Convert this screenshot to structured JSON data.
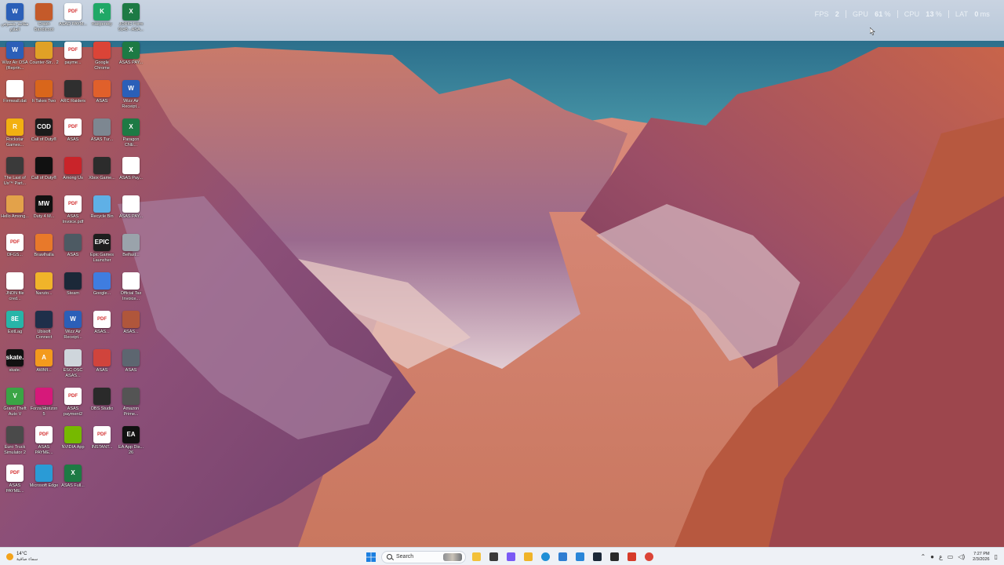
{
  "performance_overlay": {
    "fps": {
      "label": "FPS",
      "value": "2",
      "unit": ""
    },
    "gpu": {
      "label": "GPU",
      "value": "61",
      "unit": "%"
    },
    "cpu": {
      "label": "CPU",
      "value": "13",
      "unit": "%"
    },
    "latency": {
      "label": "LAT",
      "value": "0",
      "unit": "ms"
    }
  },
  "desktop_icons": [
    {
      "label": "مكاتبة بخصوص العلاج",
      "icon": "word-doc-icon",
      "badge": "W",
      "color": "#2b5fb8"
    },
    {
      "label": "Crash Bandicoot",
      "icon": "game-icon",
      "badge": "",
      "color": "#c45a2a"
    },
    {
      "label": "ASAD PAYM...",
      "icon": "pdf-icon",
      "badge": "PDF",
      "color": "#ffffff"
    },
    {
      "label": "Kaspersky",
      "icon": "kaspersky-icon",
      "badge": "K",
      "color": "#1fa866"
    },
    {
      "label": "JORIC Form 9145 - ASA...",
      "icon": "excel-icon",
      "badge": "X",
      "color": "#1d7a44"
    },
    {
      "label": "Wizz Air OSA (Reprin...",
      "icon": "word-doc-icon",
      "badge": "W",
      "color": "#2b5fb8"
    },
    {
      "label": "Counter-Str... 2",
      "icon": "game-icon",
      "badge": "",
      "color": "#e0a126"
    },
    {
      "label": "payme...",
      "icon": "pdf-icon",
      "badge": "PDF",
      "color": "#ffffff"
    },
    {
      "label": "Google Chrome",
      "icon": "chrome-icon",
      "badge": "",
      "color": "#db4437"
    },
    {
      "label": "ASAS PAY...",
      "icon": "excel-icon",
      "badge": "X",
      "color": "#1d7a44"
    },
    {
      "label": "Firmwall.dat",
      "icon": "file-icon",
      "badge": "",
      "color": "#ffffff"
    },
    {
      "label": "It Takes Two",
      "icon": "game-icon",
      "badge": "",
      "color": "#d9661b"
    },
    {
      "label": "ARC Raiders",
      "icon": "game-icon",
      "badge": "",
      "color": "#2f2f2f"
    },
    {
      "label": "ASAS",
      "icon": "game-icon",
      "badge": "",
      "color": "#e0602b"
    },
    {
      "label": "Wizz Air Receipt...",
      "icon": "word-doc-icon",
      "badge": "W",
      "color": "#2b5fb8"
    },
    {
      "label": "Rockstar Games...",
      "icon": "rockstar-icon",
      "badge": "R",
      "color": "#f2b011"
    },
    {
      "label": "Call of Duty®",
      "icon": "game-icon",
      "badge": "COD",
      "color": "#1b1b1b"
    },
    {
      "label": "ASAS",
      "icon": "pdf-icon",
      "badge": "PDF",
      "color": "#ffffff"
    },
    {
      "label": "ASAS Tur...",
      "icon": "app-icon",
      "badge": "",
      "color": "#7d8791"
    },
    {
      "label": "Paragon CNE...",
      "icon": "excel-icon",
      "badge": "X",
      "color": "#1d7a44"
    },
    {
      "label": "The Last of Us™ Part...",
      "icon": "game-icon",
      "badge": "",
      "color": "#3a3a3a"
    },
    {
      "label": "Call of Duty®",
      "icon": "game-icon",
      "badge": "",
      "color": "#111111"
    },
    {
      "label": "Among Us",
      "icon": "game-icon",
      "badge": "",
      "color": "#c9242a"
    },
    {
      "label": "Xbox Game...",
      "icon": "xbox-icon",
      "badge": "",
      "color": "#2c2c2c"
    },
    {
      "label": "ASAS Pay...",
      "icon": "file-icon",
      "badge": "",
      "color": "#ffffff"
    },
    {
      "label": "Hello Among...",
      "icon": "game-icon",
      "badge": "",
      "color": "#e3a24a"
    },
    {
      "label": "Duty 4 M...",
      "icon": "game-icon",
      "badge": "MW",
      "color": "#111111"
    },
    {
      "label": "ASAS Invoice.pdf",
      "icon": "pdf-icon",
      "badge": "PDF",
      "color": "#ffffff"
    },
    {
      "label": "Recycle Bin",
      "icon": "recycle-bin-icon",
      "badge": "",
      "color": "#5fb0e6"
    },
    {
      "label": "ASAS PAY...",
      "icon": "file-icon",
      "badge": "",
      "color": "#ffffff"
    },
    {
      "label": "DFGS...",
      "icon": "pdf-icon",
      "badge": "PDF",
      "color": "#ffffff"
    },
    {
      "label": "Brawlhalla",
      "icon": "game-icon",
      "badge": "",
      "color": "#e8792a"
    },
    {
      "label": "ASAS",
      "icon": "app-icon",
      "badge": "",
      "color": "#4d5a63"
    },
    {
      "label": "Epic Games Launcher",
      "icon": "epic-icon",
      "badge": "EPIC",
      "color": "#1e1e1e"
    },
    {
      "label": "Belfast...",
      "icon": "app-icon",
      "badge": "",
      "color": "#9aa3ab"
    },
    {
      "label": "JNDN file cred...",
      "icon": "file-icon",
      "badge": "",
      "color": "#ffffff"
    },
    {
      "label": "Naruto...",
      "icon": "game-icon",
      "badge": "",
      "color": "#f0b42a"
    },
    {
      "label": "Steam",
      "icon": "steam-icon",
      "badge": "",
      "color": "#1b2838"
    },
    {
      "label": "Google...",
      "icon": "app-icon",
      "badge": "",
      "color": "#3f7de0"
    },
    {
      "label": "Official Tax Invoice...",
      "icon": "file-icon",
      "badge": "",
      "color": "#ffffff"
    },
    {
      "label": "ExitLag",
      "icon": "app-icon",
      "badge": "8E",
      "color": "#27b5a8"
    },
    {
      "label": "Ubisoft Connect",
      "icon": "ubisoft-icon",
      "badge": "",
      "color": "#1f2f4a"
    },
    {
      "label": "Wizz Air Receipt...",
      "icon": "word-doc-icon",
      "badge": "W",
      "color": "#2b5fb8"
    },
    {
      "label": "ASAS...",
      "icon": "pdf-icon",
      "badge": "PDF",
      "color": "#ffffff"
    },
    {
      "label": "ASAS...",
      "icon": "game-icon",
      "badge": "",
      "color": "#b0563b"
    },
    {
      "label": "skate.",
      "icon": "skate-icon",
      "badge": "skate.",
      "color": "#111111"
    },
    {
      "label": "AWMI...",
      "icon": "app-icon",
      "badge": "A",
      "color": "#f39a1d"
    },
    {
      "label": "ESC OSC ASAS...",
      "icon": "file-icon",
      "badge": "",
      "color": "#cfd6dc"
    },
    {
      "label": "ASAS",
      "icon": "app-icon",
      "badge": "",
      "color": "#d0443c"
    },
    {
      "label": "ASAS",
      "icon": "app-icon",
      "badge": "",
      "color": "#5d6670"
    },
    {
      "label": "Grand Theft Auto V",
      "icon": "gta-icon",
      "badge": "V",
      "color": "#3aa545"
    },
    {
      "label": "Forza Horizon 5",
      "icon": "forza-icon",
      "badge": "",
      "color": "#d6197a"
    },
    {
      "label": "ASAS payment2",
      "icon": "pdf-icon",
      "badge": "PDF",
      "color": "#ffffff"
    },
    {
      "label": "OBS Studio",
      "icon": "obs-icon",
      "badge": "",
      "color": "#2a2a2a"
    },
    {
      "label": "Amazon Prime...",
      "icon": "app-icon",
      "badge": "",
      "color": "#545454"
    },
    {
      "label": "Euro Truck Simulator 2",
      "icon": "game-icon",
      "badge": "",
      "color": "#4a4a4a"
    },
    {
      "label": "ASAS PAYME...",
      "icon": "pdf-icon",
      "badge": "PDF",
      "color": "#ffffff"
    },
    {
      "label": "NVIDIA App",
      "icon": "nvidia-icon",
      "badge": "",
      "color": "#76b900"
    },
    {
      "label": "INSTANT...",
      "icon": "pdf-icon",
      "badge": "PDF",
      "color": "#ffffff"
    },
    {
      "label": "EA App Dis... 26",
      "icon": "ea-icon",
      "badge": "EA",
      "color": "#111111"
    },
    {
      "label": "ASAS PAYME...",
      "icon": "pdf-icon",
      "badge": "PDF",
      "color": "#ffffff"
    },
    {
      "label": "Microsoft Edge",
      "icon": "edge-icon",
      "badge": "",
      "color": "#2a9bd6"
    },
    {
      "label": "ASAS Full...",
      "icon": "excel-icon",
      "badge": "X",
      "color": "#1d7a44"
    }
  ],
  "taskbar": {
    "weather": {
      "temperature": "14°C",
      "condition": "سماء صافية"
    },
    "search_placeholder": "Search",
    "pinned_apps": [
      {
        "name": "file-explorer-icon",
        "color": "#f3c13a"
      },
      {
        "name": "task-view-icon",
        "color": "#3a3a3a"
      },
      {
        "name": "copilot-icon",
        "color": "#7a5af5"
      },
      {
        "name": "folder-icon",
        "color": "#f0b429"
      },
      {
        "name": "edge-icon",
        "color": "#1f8fd6"
      },
      {
        "name": "store-icon",
        "color": "#2f7dd1"
      },
      {
        "name": "photos-icon",
        "color": "#2a86d8"
      },
      {
        "name": "steam-icon",
        "color": "#1b2838"
      },
      {
        "name": "epic-games-icon",
        "color": "#2b2b2b"
      },
      {
        "name": "media-icon",
        "color": "#d63b2a"
      },
      {
        "name": "chrome-icon",
        "color": "#db4437"
      }
    ],
    "clock": {
      "time": "7:27 PM",
      "date": "2/3/2026"
    }
  }
}
